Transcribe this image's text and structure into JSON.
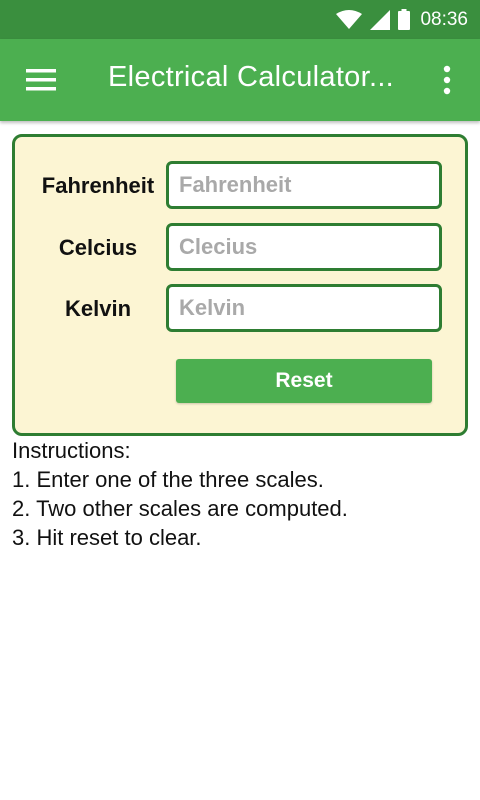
{
  "status_bar": {
    "time": "08:36",
    "icons": [
      "wifi-icon",
      "signal-icon",
      "battery-icon"
    ]
  },
  "app_bar": {
    "title": "Electrical Calculator...",
    "menu_icon": "hamburger-menu-icon",
    "overflow_icon": "more-vert-icon"
  },
  "converter": {
    "fahrenheit": {
      "label": "Fahrenheit",
      "value": "",
      "placeholder": "Fahrenheit"
    },
    "celcius": {
      "label": "Celcius",
      "value": "",
      "placeholder": "Clecius"
    },
    "kelvin": {
      "label": "Kelvin",
      "value": "",
      "placeholder": "Kelvin"
    },
    "reset_label": "Reset"
  },
  "instructions": {
    "heading": "Instructions:",
    "steps": [
      "1. Enter one of the three scales.",
      "2. Two other scales are computed.",
      "3. Hit reset to clear."
    ]
  },
  "colors": {
    "status_bar": "#3a8f3e",
    "app_bar": "#4caf50",
    "card_background": "#fcf5d3",
    "card_border": "#2e7d32",
    "button": "#4caf50"
  }
}
